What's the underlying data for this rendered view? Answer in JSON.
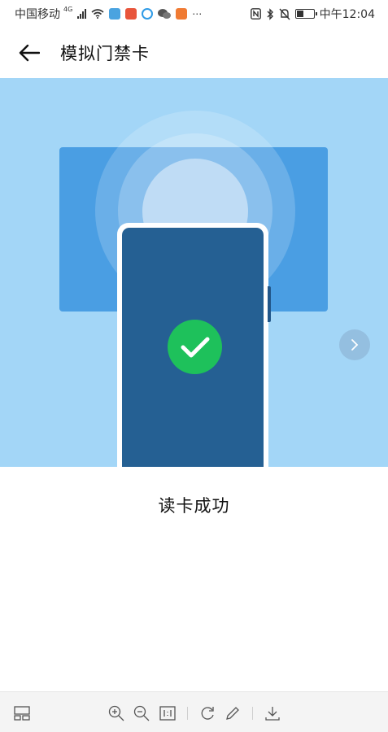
{
  "status_bar": {
    "carrier": "中国移动",
    "network": "4G",
    "time": "中午12:04"
  },
  "header": {
    "title": "模拟门禁卡"
  },
  "result": {
    "text": "读卡成功"
  },
  "icons": {
    "back": "back-arrow-icon",
    "next": "chevron-right-icon",
    "success": "checkmark-icon"
  },
  "colors": {
    "hero_background": "#a3d6f7",
    "reader": "#4a9ee3",
    "phone_screen": "#256093",
    "success": "#1ec15b"
  }
}
